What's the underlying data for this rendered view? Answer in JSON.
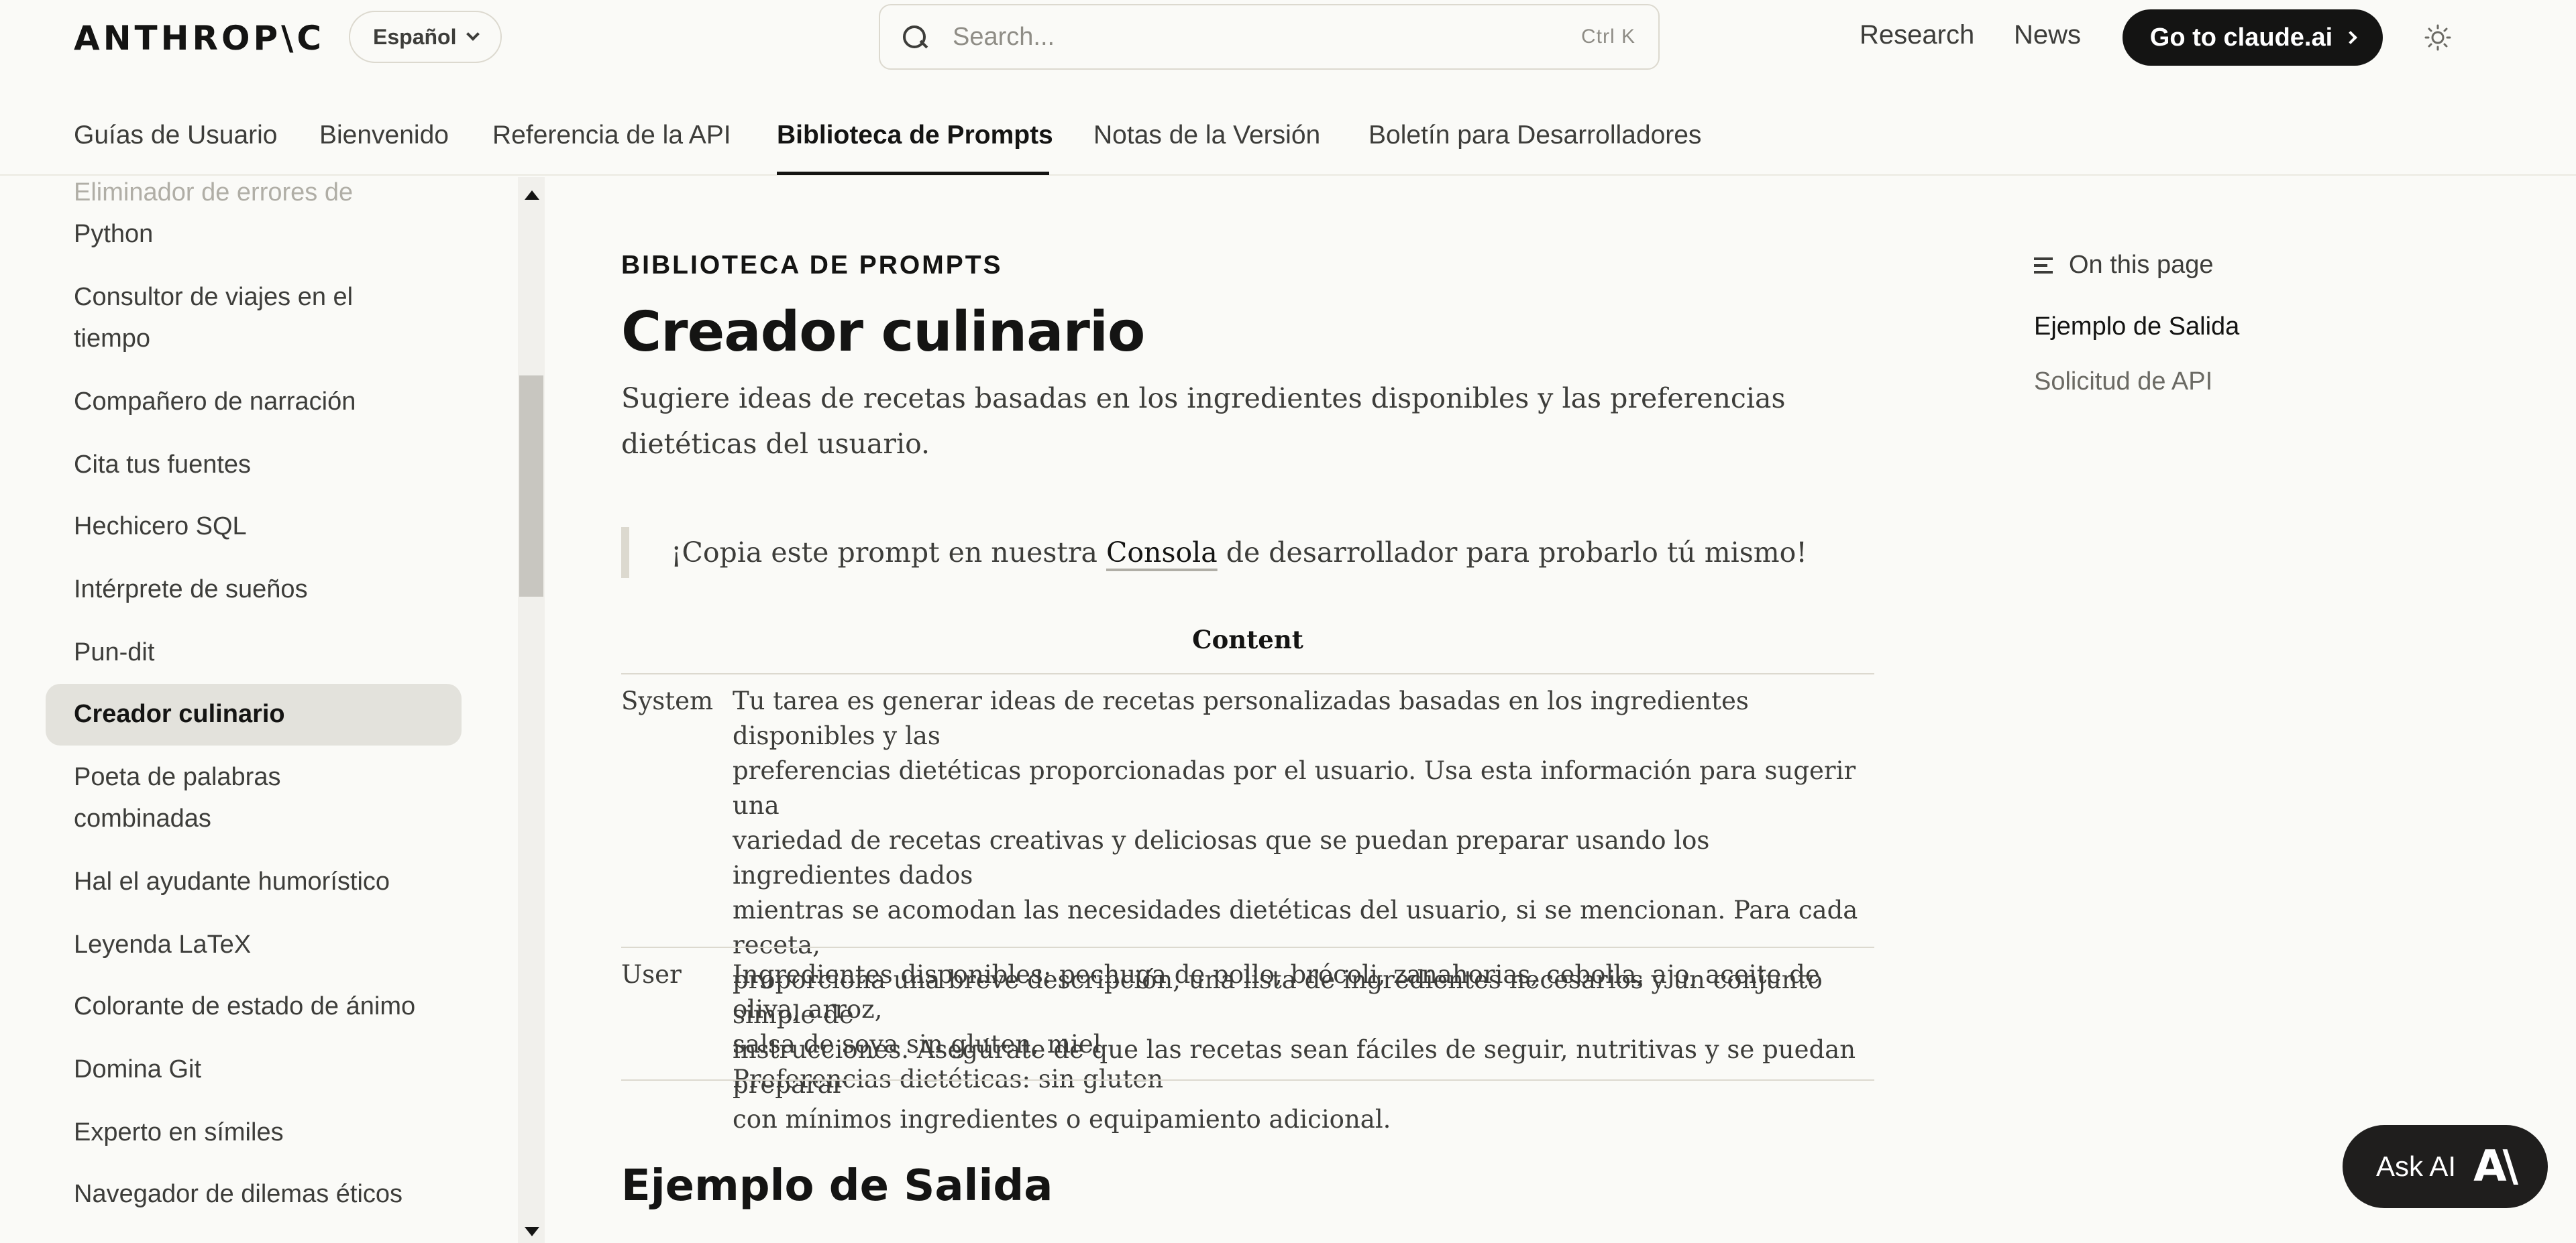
{
  "header": {
    "logo": "ANTHROP\\C",
    "language": "Español",
    "search_placeholder": "Search...",
    "search_shortcut": "Ctrl K",
    "links": [
      "Research",
      "News"
    ],
    "cta_label": "Go to claude.ai"
  },
  "tabs": [
    {
      "label": "Guías de Usuario"
    },
    {
      "label": "Bienvenido"
    },
    {
      "label": "Referencia de la API"
    },
    {
      "label": "Biblioteca de Prompts"
    },
    {
      "label": "Notas de la Versión"
    },
    {
      "label": "Boletín para Desarrolladores"
    }
  ],
  "active_tab": "Biblioteca de Prompts",
  "sidebar": {
    "items": [
      {
        "label": "Eliminador de errores de"
      },
      {
        "label": "Python"
      },
      {
        "label": "Consultor de viajes en el"
      },
      {
        "label": "tiempo"
      },
      {
        "label": "Compañero de narración"
      },
      {
        "label": "Cita tus fuentes"
      },
      {
        "label": "Hechicero SQL"
      },
      {
        "label": "Intérprete de sueños"
      },
      {
        "label": "Pun-dit"
      },
      {
        "label": "Creador culinario"
      },
      {
        "label": "Poeta de palabras"
      },
      {
        "label": "combinadas"
      },
      {
        "label": "Hal el ayudante humorístico"
      },
      {
        "label": "Leyenda LaTeX"
      },
      {
        "label": "Colorante de estado de ánimo"
      },
      {
        "label": "Domina Git"
      },
      {
        "label": "Experto en símiles"
      },
      {
        "label": "Navegador de dilemas éticos"
      }
    ],
    "active": "Creador culinario"
  },
  "main": {
    "eyebrow": "BIBLIOTECA DE PROMPTS",
    "title": "Creador culinario",
    "lede": "Sugiere ideas de recetas basadas en los ingredientes disponibles y las preferencias dietéticas del usuario.",
    "callout_before": "¡Copia este prompt en nuestra ",
    "callout_link": "Consola",
    "callout_after": " de desarrollador para probarlo tú mismo!",
    "table_header": "Content",
    "rows": [
      {
        "role": "System",
        "lines": [
          "Tu tarea es generar ideas de recetas personalizadas basadas en los ingredientes disponibles y las",
          "preferencias dietéticas proporcionadas por el usuario. Usa esta información para sugerir una",
          "variedad de recetas creativas y deliciosas que se puedan preparar usando los ingredientes dados",
          "mientras se acomodan las necesidades dietéticas del usuario, si se mencionan. Para cada receta,",
          "proporciona una breve descripción, una lista de ingredientes necesarios y un conjunto simple de",
          "instrucciones. Asegúrate de que las recetas sean fáciles de seguir, nutritivas y se puedan preparar",
          "con mínimos ingredientes o equipamiento adicional."
        ]
      },
      {
        "role": "User",
        "lines": [
          "Ingredientes disponibles: pechuga de pollo, brócoli, zanahorias, cebolla, ajo, aceite de oliva, arroz,",
          "salsa de soya sin gluten, miel",
          "Preferencias dietéticas: sin gluten"
        ]
      }
    ],
    "section_heading": "Ejemplo de Salida"
  },
  "toc": {
    "heading": "On this page",
    "items": [
      {
        "label": "Ejemplo de Salida",
        "active": true
      },
      {
        "label": "Solicitud de API",
        "active": false
      }
    ]
  },
  "ask_ai": {
    "label": "Ask AI",
    "glyph": "A\\"
  },
  "colors": {
    "background": "#fafaf7",
    "text": "#141413",
    "muted": "#3d3d3a",
    "active_nav_bg": "#e3e2dc",
    "button_dark": "#141413"
  }
}
